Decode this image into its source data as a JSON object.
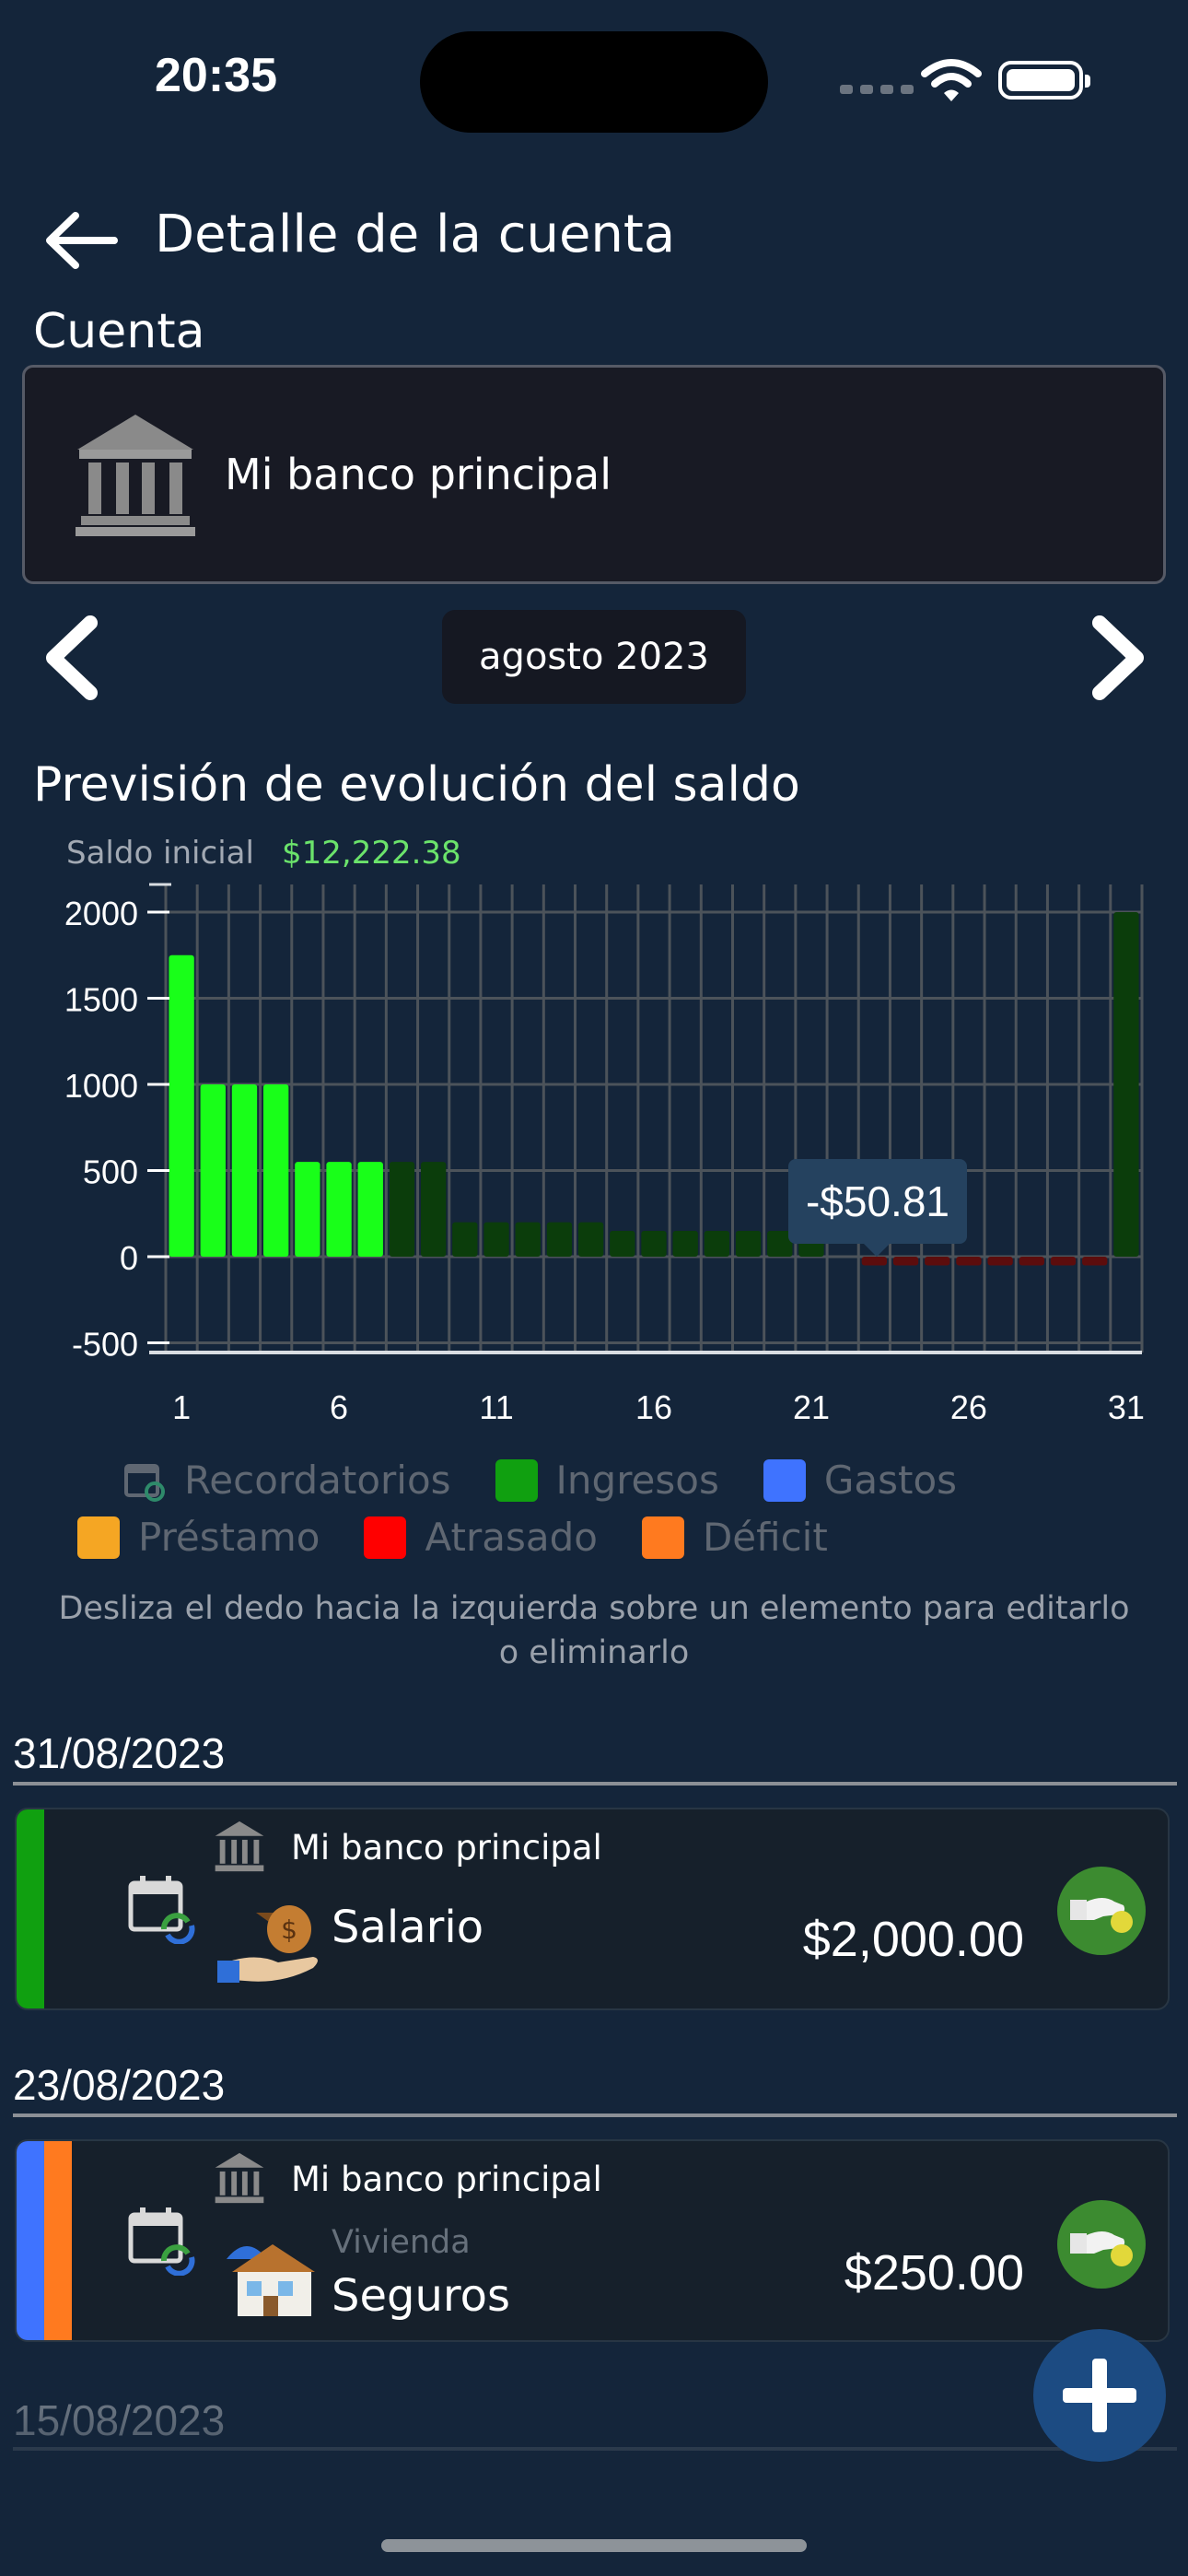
{
  "status_bar": {
    "time": "20:35"
  },
  "header": {
    "title": "Detalle de la cuenta"
  },
  "account": {
    "section_label": "Cuenta",
    "name": "Mi banco principal",
    "icon": "bank-icon"
  },
  "month_nav": {
    "month": "agosto 2023"
  },
  "chart_section": {
    "title": "Previsión de evolución del saldo",
    "saldo_label": "Saldo inicial",
    "saldo_value": "$12,222.38",
    "tooltip": "-$50.81"
  },
  "chart_data": {
    "type": "bar",
    "x": [
      1,
      2,
      3,
      4,
      5,
      6,
      7,
      8,
      9,
      10,
      11,
      12,
      13,
      14,
      15,
      16,
      17,
      18,
      19,
      20,
      21,
      22,
      23,
      24,
      25,
      26,
      27,
      28,
      29,
      30,
      31
    ],
    "values": [
      1750,
      1000,
      1000,
      1000,
      550,
      550,
      550,
      550,
      550,
      200,
      200,
      200,
      200,
      200,
      150,
      150,
      150,
      150,
      150,
      150,
      150,
      0,
      -50.81,
      -50.81,
      -50.81,
      -50.81,
      -50.81,
      -50.81,
      -50.81,
      -50.81,
      2000
    ],
    "bar_status": [
      "bright",
      "bright",
      "bright",
      "bright",
      "bright",
      "bright",
      "bright",
      "dim",
      "dim",
      "dim",
      "dim",
      "dim",
      "dim",
      "dim",
      "dim",
      "dim",
      "dim",
      "dim",
      "dim",
      "dim",
      "dim",
      "dim",
      "negative",
      "negative",
      "negative",
      "negative",
      "negative",
      "negative",
      "negative",
      "negative",
      "dim"
    ],
    "x_ticks": [
      "1",
      "6",
      "11",
      "16",
      "21",
      "26",
      "31"
    ],
    "y_ticks": [
      2000,
      1500,
      1000,
      500,
      0,
      -500
    ],
    "ylim": [
      -500,
      2000
    ],
    "grid": true,
    "colors": {
      "bright": "#19ff19",
      "dim": "#0b3d0b",
      "negative": "#5c0d0d",
      "grid": "#4c535a",
      "axis": "#d9dde2"
    }
  },
  "legend": {
    "row1": [
      {
        "label": "Recordatorios",
        "icon": "calendar-sync-icon"
      },
      {
        "label": "Ingresos",
        "color": "#10a010"
      },
      {
        "label": "Gastos",
        "color": "#3f73ff"
      }
    ],
    "row2": [
      {
        "label": "Préstamo",
        "color": "#f5a623"
      },
      {
        "label": "Atrasado",
        "color": "#ff0000"
      },
      {
        "label": "Déficit",
        "color": "#ff7a1f"
      }
    ]
  },
  "hint": "Desliza el dedo hacia la izquierda sobre un elemento para editarlo o eliminarlo",
  "transactions": [
    {
      "date": "31/08/2023",
      "account": "Mi banco principal",
      "category": "",
      "name": "Salario",
      "amount": "$2,000.00",
      "bar_colors": [
        "#10a010"
      ],
      "icon": "salary-money-bag-icon"
    },
    {
      "date": "23/08/2023",
      "account": "Mi banco principal",
      "category": "Vivienda",
      "name": "Seguros",
      "amount": "$250.00",
      "bar_colors": [
        "#3f73ff",
        "#ff7a1f"
      ],
      "icon": "house-insurance-icon"
    }
  ],
  "next_date": "15/08/2023"
}
